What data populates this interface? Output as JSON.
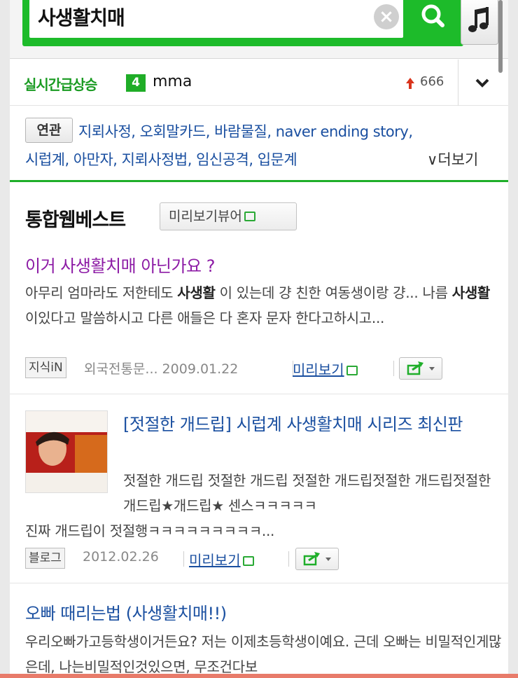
{
  "search": {
    "query": "사생활치매",
    "clear_icon": "close-icon",
    "search_icon": "search-icon",
    "music_icon": "music-note-icon",
    "accent_color": "#1dbb2a"
  },
  "trending": {
    "label": "실시간급상승",
    "rank": "4",
    "keyword": "mma",
    "count": "666",
    "trend_icon": "up-arrow-icon",
    "toggle_icon": "chevron-down-icon"
  },
  "related": {
    "badge": "연관",
    "line1": "지뢰사정, 오회말카드, 바람물질, naver ending story,",
    "line2": "시럽계, 아만자, 지뢰사정법, 임신공격, 입문계",
    "more": "더보기",
    "more_prefix": "∨"
  },
  "section": {
    "title": "통합웹베스트",
    "preview_viewer": "미리보기뷰어"
  },
  "results": [
    {
      "title": "이거 사생활치매 아닌가요 ?",
      "desc_parts": [
        "아무리 엄마라도 저한테도 ",
        "사생활",
        " 이 있는데 걍 친한 여동생이랑 걍... 나름 ",
        "사생활",
        "이있다고 말씀하시고 다른 애들은 다 혼자 문자 한다고하시고..."
      ],
      "tag": "지식iN",
      "source": "외국전통문... 2009.01.22",
      "link": "미리보기"
    },
    {
      "title": "[젓절한 개드립] 시럽계 사생활치매 시리즈 최신판",
      "desc": "젓절한 개드립 젓절한 개드립 젓절한 개드립젓절한 개드립젓절한 개드립★개드립★ 센스ㅋㅋㅋㅋㅋ",
      "desc2": "진짜 개드립이 젓절행ㅋㅋㅋㅋㅋㅋㅋㅋㅋ...",
      "tag": "블로그",
      "source": "2012.02.26",
      "link": "미리보기"
    },
    {
      "title": "오빠 때리는법 (사생활치매!!)",
      "desc": "우리오빠가고등학생이거든요? 저는 이제초등학생이예요. 근데 오빠는 비밀적인게많은데, 나는비밀적인것있으면, 무조건다보"
    }
  ]
}
